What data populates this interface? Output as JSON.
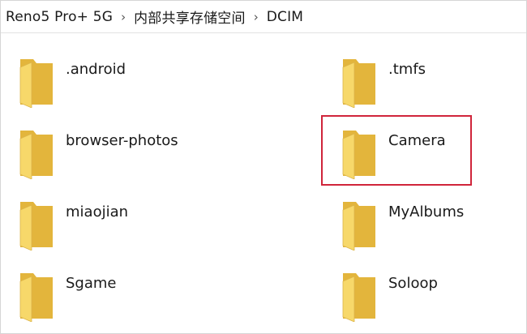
{
  "breadcrumb": {
    "items": [
      "Reno5 Pro+ 5G",
      "内部共享存储空间",
      "DCIM"
    ],
    "separator": "›"
  },
  "folders": [
    {
      "name": ".android"
    },
    {
      "name": ".tmfs"
    },
    {
      "name": "browser-photos"
    },
    {
      "name": "Camera"
    },
    {
      "name": "miaojian"
    },
    {
      "name": "MyAlbums"
    },
    {
      "name": "Sgame"
    },
    {
      "name": "Soloop"
    }
  ],
  "colors": {
    "folder_front": "#F7D86A",
    "folder_back": "#E3B53C",
    "highlight": "#D0253B"
  },
  "icons": {
    "folder": "folder-icon",
    "chevron": "chevron-right-icon"
  }
}
